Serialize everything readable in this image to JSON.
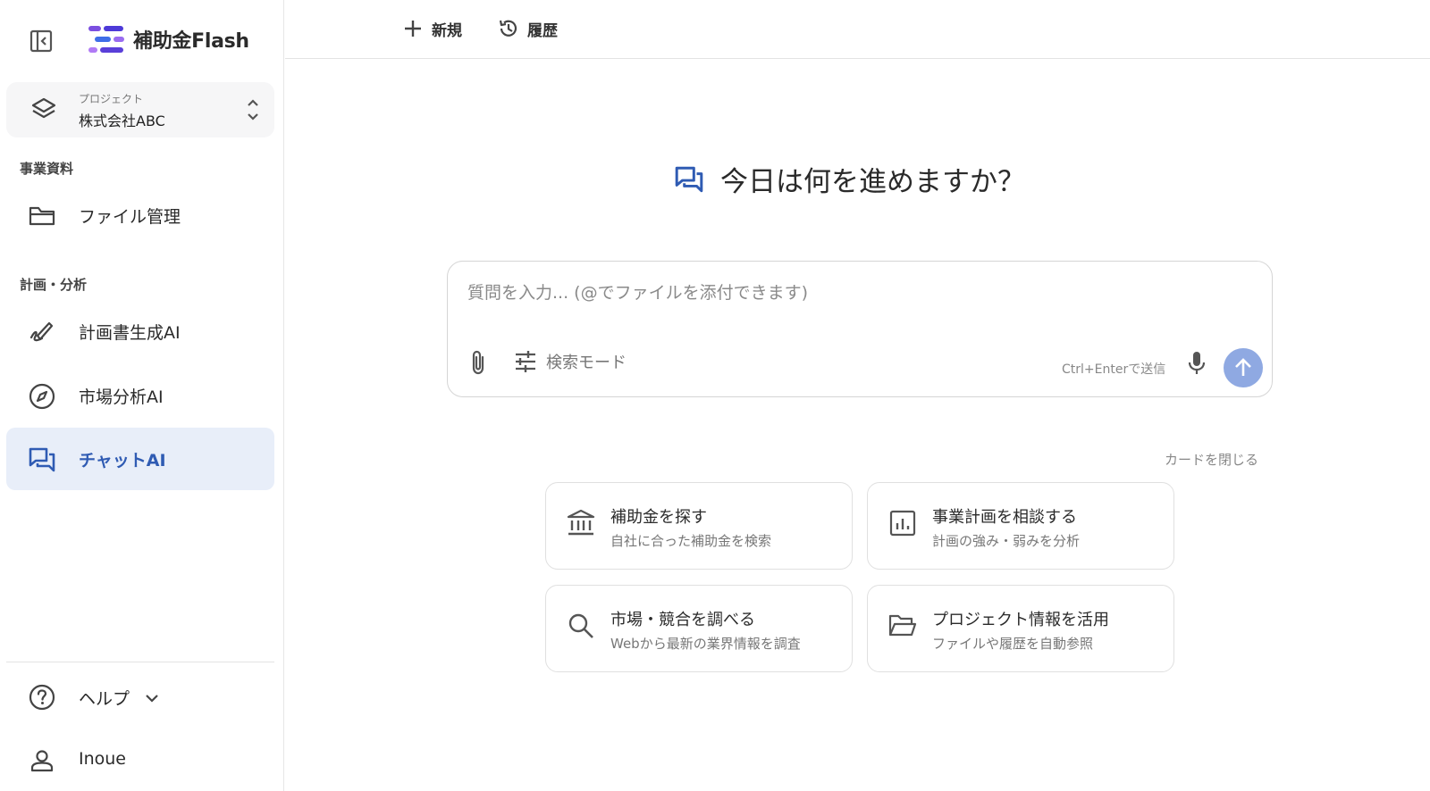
{
  "app": {
    "logo_text": "補助金Flash"
  },
  "colors": {
    "accent": "#2f5bb3",
    "active_bg": "#e8eef9",
    "send_button": "#8fa9e2",
    "logo_purple": "#7b4fe0"
  },
  "project": {
    "label": "プロジェクト",
    "name": "株式会社ABC"
  },
  "sidebar": {
    "sections": [
      {
        "label": "事業資料",
        "items": [
          {
            "label": "ファイル管理",
            "icon": "folder-icon"
          }
        ]
      },
      {
        "label": "計画・分析",
        "items": [
          {
            "label": "計画書生成AI",
            "icon": "pen-icon"
          },
          {
            "label": "市場分析AI",
            "icon": "compass-icon"
          },
          {
            "label": "チャットAI",
            "icon": "chat-icon",
            "active": true
          }
        ]
      }
    ],
    "help_label": "ヘルプ",
    "user_name": "Inoue"
  },
  "topbar": {
    "new_label": "新規",
    "history_label": "履歴"
  },
  "main": {
    "heading": "今日は何を進めますか？",
    "composer": {
      "placeholder": "質問を入力... (@でファイルを添付できます)",
      "mode_label": "検索モード",
      "hint": "Ctrl+Enterで送信"
    },
    "close_cards_label": "カードを閉じる",
    "cards": [
      {
        "title": "補助金を探す",
        "desc": "自社に合った補助金を検索",
        "icon": "bank-icon"
      },
      {
        "title": "事業計画を相談する",
        "desc": "計画の強み・弱みを分析",
        "icon": "analytics-icon"
      },
      {
        "title": "市場・競合を調べる",
        "desc": "Webから最新の業界情報を調査",
        "icon": "search-icon"
      },
      {
        "title": "プロジェクト情報を活用",
        "desc": "ファイルや履歴を自動参照",
        "icon": "folder-open-icon"
      }
    ]
  }
}
